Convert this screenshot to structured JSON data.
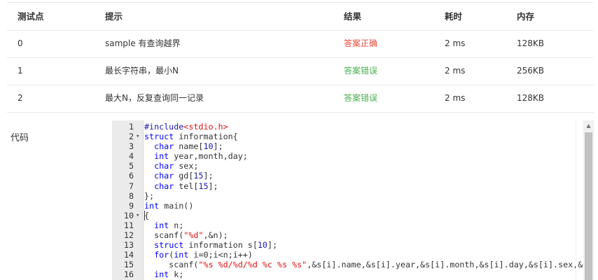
{
  "results_table": {
    "headers": [
      "测试点",
      "提示",
      "结果",
      "耗时",
      "内存"
    ],
    "rows": [
      {
        "id": "0",
        "hint": "sample 有查询越界",
        "result": "答案正确",
        "status": "accepted",
        "time": "2 ms",
        "memory": "128KB"
      },
      {
        "id": "1",
        "hint": "最长字符串，最小N",
        "result": "答案错误",
        "status": "wrong",
        "time": "2 ms",
        "memory": "256KB"
      },
      {
        "id": "2",
        "hint": "最大N，反复查询同一记录",
        "result": "答案错误",
        "status": "wrong",
        "time": "2 ms",
        "memory": "128KB"
      }
    ]
  },
  "code_section": {
    "label": "代码",
    "lines": [
      {
        "num": "1",
        "text": "#include<stdio.h>",
        "fold": false
      },
      {
        "num": "2",
        "text": "struct information{",
        "fold": true
      },
      {
        "num": "3",
        "text": "  char name[10];",
        "fold": false
      },
      {
        "num": "4",
        "text": "  int year,month,day;",
        "fold": false
      },
      {
        "num": "5",
        "text": "  char sex;",
        "fold": false
      },
      {
        "num": "6",
        "text": "  char gd[15];",
        "fold": false
      },
      {
        "num": "7",
        "text": "  char tel[15];",
        "fold": false
      },
      {
        "num": "8",
        "text": "};",
        "fold": false
      },
      {
        "num": "9",
        "text": "int main()",
        "fold": false
      },
      {
        "num": "10",
        "text": "{",
        "fold": true
      },
      {
        "num": "11",
        "text": "  int n;",
        "fold": false
      },
      {
        "num": "12",
        "text": "  scanf(\"%d\",&n);",
        "fold": false
      },
      {
        "num": "13",
        "text": "  struct information s[10];",
        "fold": false
      },
      {
        "num": "14",
        "text": "  for(int i=0;i<n;i++)",
        "fold": false
      },
      {
        "num": "15",
        "text": "     scanf(\"%s %d/%d/%d %c %s %s\",&s[i].name,&s[i].year,&s[i].month,&s[i].day,&s[i].sex,&s",
        "fold": false
      },
      {
        "num": "16",
        "text": "  int k;",
        "fold": false
      }
    ]
  },
  "colors": {
    "accepted": "#e74c3c",
    "wrong": "#4caf50",
    "keyword": "#0000ff",
    "string": "#dd1111"
  }
}
